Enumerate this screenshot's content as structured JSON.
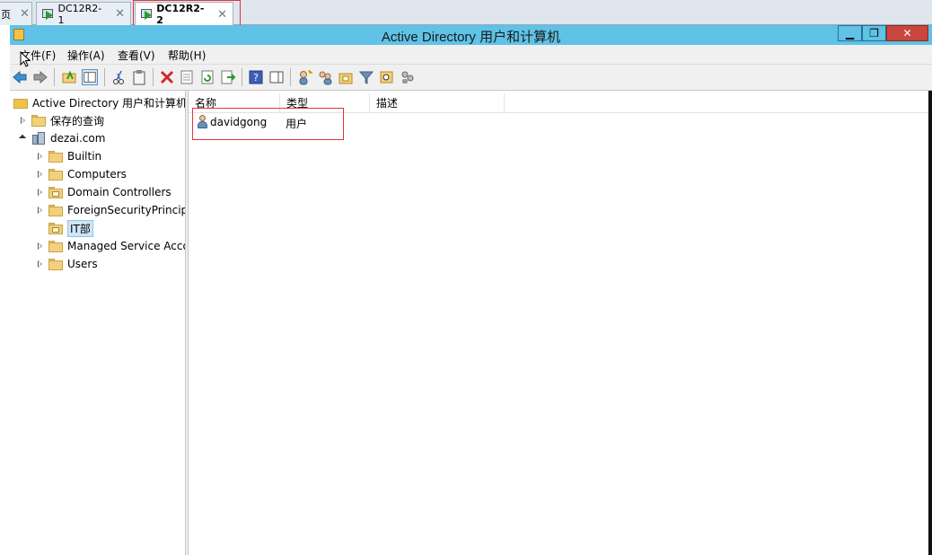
{
  "vm_tabs": [
    {
      "label": "页",
      "close": "✕"
    },
    {
      "label": "DC12R2-1",
      "close": "✕"
    },
    {
      "label": "DC12R2-2",
      "close": "✕"
    }
  ],
  "window": {
    "title": "Active Directory 用户和计算机",
    "min_glyph": "▁",
    "restore_glyph": "❐",
    "close_glyph": "✕"
  },
  "menu": [
    {
      "label": "文件(F)"
    },
    {
      "label": "操作(A)"
    },
    {
      "label": "查看(V)"
    },
    {
      "label": "帮助(H)"
    }
  ],
  "tree": {
    "root": "Active Directory 用户和计算机",
    "saved_queries": "保存的查询",
    "domain": "dezai.com",
    "children": [
      {
        "label": "Builtin"
      },
      {
        "label": "Computers"
      },
      {
        "label": "Domain Controllers"
      },
      {
        "label": "ForeignSecurityPrincipals"
      },
      {
        "label": "IT部"
      },
      {
        "label": "Managed Service Accounts"
      },
      {
        "label": "Users"
      }
    ]
  },
  "list": {
    "columns": [
      "名称",
      "类型",
      "描述"
    ],
    "rows": [
      {
        "name": "davidgong",
        "type": "用户",
        "description": ""
      }
    ]
  },
  "colors": {
    "title_bar": "#5fc2e6",
    "highlight": "#e0353b",
    "selection": "#cfe6f7"
  }
}
